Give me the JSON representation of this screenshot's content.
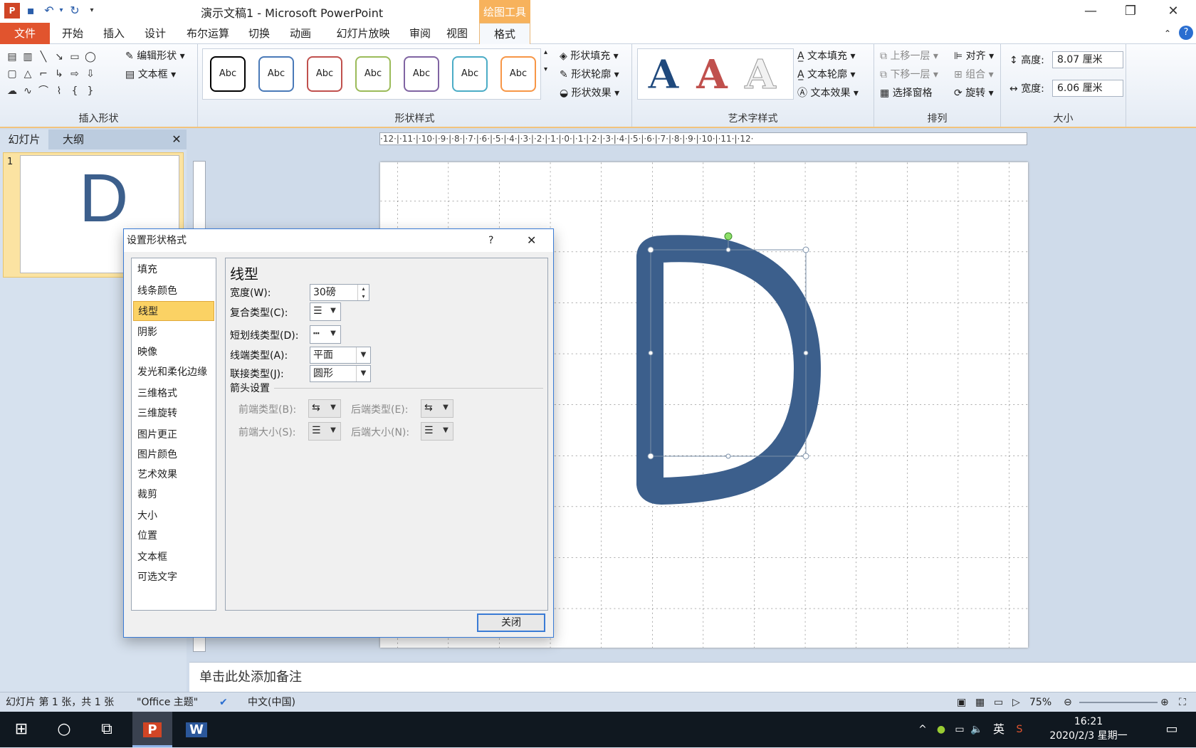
{
  "window": {
    "title": "演示文稿1 - Microsoft PowerPoint",
    "context_tab": "绘图工具",
    "minimize": "—",
    "maximize": "❐",
    "close": "✕"
  },
  "tabs": [
    "文件",
    "开始",
    "插入",
    "设计",
    "布尔运算",
    "切换",
    "动画",
    "幻灯片放映",
    "审阅",
    "视图",
    "格式"
  ],
  "ribbon": {
    "insert_shapes": {
      "label": "插入形状",
      "edit_shape": "编辑形状",
      "text_box": "文本框"
    },
    "shape_styles": {
      "label": "形状样式",
      "sample": "Abc",
      "fill": "形状填充",
      "outline": "形状轮廓",
      "effects": "形状效果",
      "colors": [
        "#000000",
        "#4a7ab8",
        "#c0504d",
        "#9bbb59",
        "#8064a2",
        "#4bacc6",
        "#f79646"
      ]
    },
    "wordart": {
      "label": "艺术字样式",
      "fill": "文本填充",
      "outline": "文本轮廓",
      "effects": "文本效果",
      "letter": "A"
    },
    "arrange": {
      "label": "排列",
      "bring_forward": "上移一层",
      "send_backward": "下移一层",
      "align": "对齐",
      "group": "组合",
      "selection_pane": "选择窗格",
      "rotate": "旋转"
    },
    "size": {
      "label": "大小",
      "height_label": "高度:",
      "height": "8.07 厘米",
      "width_label": "宽度:",
      "width": "6.06 厘米"
    }
  },
  "panel": {
    "tab_slides": "幻灯片",
    "tab_outline": "大纲",
    "slide_number": "1",
    "thumb_letter": "D"
  },
  "ruler": {
    "marks": "·12·|·11·|·10·|·9·|·8·|·7·|·6·|·5·|·4·|·3·|·2·|·1·|·0·|·1·|·2·|·3·|·4·|·5·|·6·|·7·|·8·|·9·|·10·|·11·|·12·"
  },
  "notes_placeholder": "单击此处添加备注",
  "dialog": {
    "title": "设置形状格式",
    "help": "?",
    "close_x": "✕",
    "nav": [
      "填充",
      "线条颜色",
      "线型",
      "阴影",
      "映像",
      "发光和柔化边缘",
      "三维格式",
      "三维旋转",
      "图片更正",
      "图片颜色",
      "艺术效果",
      "裁剪",
      "大小",
      "位置",
      "文本框",
      "可选文字"
    ],
    "heading": "线型",
    "width_label": "宽度(W):",
    "width_value": "30磅",
    "compound_label": "复合类型(C):",
    "dash_label": "短划线类型(D):",
    "cap_label": "线端类型(A):",
    "cap_value": "平面",
    "join_label": "联接类型(J):",
    "join_value": "圆形",
    "arrow_section": "箭头设置",
    "begin_type": "前端类型(B):",
    "end_type": "后端类型(E):",
    "begin_size": "前端大小(S):",
    "end_size": "后端大小(N):",
    "close_button": "关闭"
  },
  "status": {
    "slide_info": "幻灯片 第 1 张，共 1 张",
    "theme": "\"Office 主题\"",
    "language": "中文(中国)",
    "zoom": "75%"
  },
  "taskbar": {
    "ime": "英",
    "time": "16:21",
    "date": "2020/2/3 星期一"
  },
  "colors": {
    "shape": "#3c5f8c",
    "accent": "#e1542e",
    "context": "#f7b25c"
  }
}
